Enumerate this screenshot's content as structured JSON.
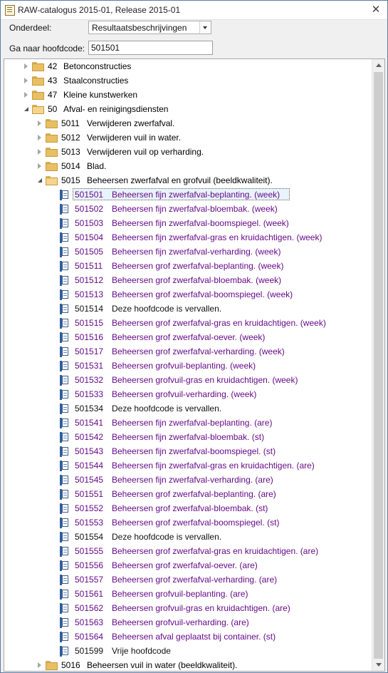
{
  "window": {
    "title": "RAW-catalogus 2015-01, Release 2015-01",
    "close_glyph": "✕"
  },
  "form": {
    "onderdeel_label": "Onderdeel:",
    "onderdeel_value": "Resultaatsbeschrijvingen",
    "goto_label": "Ga naar hoofdcode:",
    "goto_value": "501501"
  },
  "tree": {
    "top_folders": [
      {
        "code": "42",
        "label": "Betonconstructies"
      },
      {
        "code": "43",
        "label": "Staalconstructies"
      },
      {
        "code": "47",
        "label": "Kleine kunstwerken"
      },
      {
        "code": "50",
        "label": "Afval- en reinigingsdiensten"
      }
    ],
    "sub_folders": [
      {
        "code": "5011",
        "label": "Verwijderen zwerfafval."
      },
      {
        "code": "5012",
        "label": "Verwijderen vuil in water."
      },
      {
        "code": "5013",
        "label": "Verwijderen vuil op verharding."
      },
      {
        "code": "5014",
        "label": "Blad."
      },
      {
        "code": "5015",
        "label": "Beheersen zwerfafval en grofvuil (beeldkwaliteit)."
      }
    ],
    "items": [
      {
        "code": "501501",
        "label": "Beheersen fijn zwerfafval-beplanting. (week)",
        "status": "selected"
      },
      {
        "code": "501502",
        "label": "Beheersen fijn zwerfafval-bloembak. (week)",
        "status": "active"
      },
      {
        "code": "501503",
        "label": "Beheersen fijn zwerfafval-boomspiegel. (week)",
        "status": "active"
      },
      {
        "code": "501504",
        "label": "Beheersen fijn zwerfafval-gras en kruidachtigen. (week)",
        "status": "active"
      },
      {
        "code": "501505",
        "label": "Beheersen fijn zwerfafval-verharding. (week)",
        "status": "active"
      },
      {
        "code": "501511",
        "label": "Beheersen grof zwerfafval-beplanting. (week)",
        "status": "active"
      },
      {
        "code": "501512",
        "label": "Beheersen grof zwerfafval-bloembak. (week)",
        "status": "active"
      },
      {
        "code": "501513",
        "label": "Beheersen grof zwerfafval-boomspiegel. (week)",
        "status": "active"
      },
      {
        "code": "501514",
        "label": "Deze hoofdcode is vervallen.",
        "status": "void"
      },
      {
        "code": "501515",
        "label": "Beheersen grof zwerfafval-gras en kruidachtigen. (week)",
        "status": "active"
      },
      {
        "code": "501516",
        "label": "Beheersen grof zwerfafval-oever. (week)",
        "status": "active"
      },
      {
        "code": "501517",
        "label": "Beheersen grof zwerfafval-verharding. (week)",
        "status": "active"
      },
      {
        "code": "501531",
        "label": "Beheersen grofvuil-beplanting. (week)",
        "status": "active"
      },
      {
        "code": "501532",
        "label": "Beheersen grofvuil-gras en kruidachtigen. (week)",
        "status": "active"
      },
      {
        "code": "501533",
        "label": "Beheersen grofvuil-verharding. (week)",
        "status": "active"
      },
      {
        "code": "501534",
        "label": "Deze hoofdcode is vervallen.",
        "status": "void"
      },
      {
        "code": "501541",
        "label": "Beheersen fijn zwerfafval-beplanting. (are)",
        "status": "active"
      },
      {
        "code": "501542",
        "label": "Beheersen fijn zwerfafval-bloembak. (st)",
        "status": "active"
      },
      {
        "code": "501543",
        "label": "Beheersen fijn zwerfafval-boomspiegel. (st)",
        "status": "active"
      },
      {
        "code": "501544",
        "label": "Beheersen fijn zwerfafval-gras en kruidachtigen. (are)",
        "status": "active"
      },
      {
        "code": "501545",
        "label": "Beheersen fijn zwerfafval-verharding. (are)",
        "status": "active"
      },
      {
        "code": "501551",
        "label": "Beheersen grof zwerfafval-beplanting. (are)",
        "status": "active"
      },
      {
        "code": "501552",
        "label": "Beheersen grof zwerfafval-bloembak. (st)",
        "status": "active"
      },
      {
        "code": "501553",
        "label": "Beheersen grof zwerfafval-boomspiegel. (st)",
        "status": "active"
      },
      {
        "code": "501554",
        "label": "Deze hoofdcode is vervallen.",
        "status": "void"
      },
      {
        "code": "501555",
        "label": "Beheersen grof zwerfafval-gras en kruidachtigen. (are)",
        "status": "active"
      },
      {
        "code": "501556",
        "label": "Beheersen grof zwerfafval-oever. (are)",
        "status": "active"
      },
      {
        "code": "501557",
        "label": "Beheersen grof zwerfafval-verharding. (are)",
        "status": "active"
      },
      {
        "code": "501561",
        "label": "Beheersen grofvuil-beplanting. (are)",
        "status": "active"
      },
      {
        "code": "501562",
        "label": "Beheersen grofvuil-gras en kruidachtigen. (are)",
        "status": "active"
      },
      {
        "code": "501563",
        "label": "Beheersen grofvuil-verharding. (are)",
        "status": "active"
      },
      {
        "code": "501564",
        "label": "Beheersen afval geplaatst bij container. (st)",
        "status": "active"
      },
      {
        "code": "501599",
        "label": "Vrije hoofdcode",
        "status": "void"
      }
    ],
    "after_folder": {
      "code": "5016",
      "label": "Beheersen vuil in water (beeldkwaliteit)."
    }
  },
  "colors": {
    "link_purple": "#660b88",
    "text_black": "#111111",
    "folder_yellow": "#e8bf62",
    "doc_blue": "#2f5f9e"
  }
}
